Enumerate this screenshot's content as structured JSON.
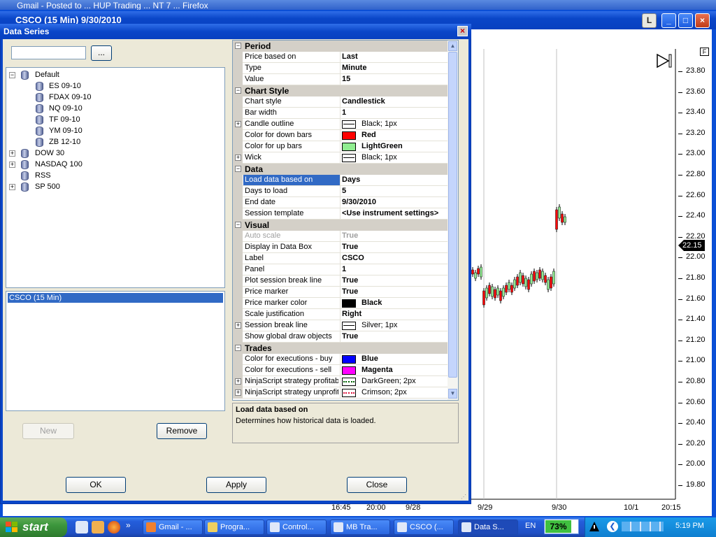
{
  "background": {
    "browser_title_fragment": "Gmail - Posted to ... HUP Trading ... NT 7 ... Firefox"
  },
  "chart_window": {
    "title": "CSCO (15 Min)  9/30/2010",
    "buttons": {
      "l": "L",
      "min": "_",
      "max": "□",
      "close": "×"
    },
    "flag": "F",
    "price_marker": "22.15",
    "y_ticks": [
      "23.80",
      "23.60",
      "23.40",
      "23.20",
      "23.00",
      "22.80",
      "22.60",
      "22.40",
      "22.20",
      "22.00",
      "21.80",
      "21.60",
      "21.40",
      "21.20",
      "21.00",
      "20.80",
      "20.60",
      "20.40",
      "20.20",
      "20.00",
      "19.80"
    ],
    "x_labels": [
      "16:45",
      "20:00",
      "9/28",
      "9/29",
      "9/30",
      "10/1",
      "20:15"
    ]
  },
  "dialog": {
    "title": "Data Series",
    "browse_button": "...",
    "tree": [
      {
        "label": "Default",
        "expanded": true,
        "children": [
          "ES 09-10",
          "FDAX 09-10",
          "NQ 09-10",
          "TF 09-10",
          "YM 09-10",
          "ZB 12-10"
        ]
      },
      {
        "label": "DOW 30"
      },
      {
        "label": "NASDAQ 100"
      },
      {
        "label": "RSS"
      },
      {
        "label": "SP 500"
      }
    ],
    "selected_series": "CSCO (15 Min)",
    "new_button": "New",
    "remove_button": "Remove",
    "ok_button": "OK",
    "apply_button": "Apply",
    "close_button": "Close",
    "help_title": "Load data based on",
    "help_text": "Determines how historical data is loaded."
  },
  "properties": [
    {
      "category": "Period"
    },
    {
      "name": "Price based on",
      "value": "Last"
    },
    {
      "name": "Type",
      "value": "Minute"
    },
    {
      "name": "Value",
      "value": "15"
    },
    {
      "category": "Chart Style"
    },
    {
      "name": "Chart style",
      "value": "Candlestick"
    },
    {
      "name": "Bar width",
      "value": "1"
    },
    {
      "name": "Candle outline",
      "value": "Black; 1px",
      "swatch": "#ffffff",
      "line": "solid",
      "expand": true
    },
    {
      "name": "Color for down bars",
      "value": "Red",
      "swatch": "#ff0000"
    },
    {
      "name": "Color for up bars",
      "value": "LightGreen",
      "swatch": "#90ee90"
    },
    {
      "name": "Wick",
      "value": "Black; 1px",
      "swatch": "#ffffff",
      "line": "solid",
      "expand": true
    },
    {
      "category": "Data"
    },
    {
      "name": "Load data based on",
      "value": "Days",
      "selected": true
    },
    {
      "name": "Days to load",
      "value": "5"
    },
    {
      "name": "End date",
      "value": "9/30/2010"
    },
    {
      "name": "Session template",
      "value": "<Use instrument settings>"
    },
    {
      "category": "Visual"
    },
    {
      "name": "Auto scale",
      "value": "True",
      "disabled": true
    },
    {
      "name": "Display in Data Box",
      "value": "True"
    },
    {
      "name": "Label",
      "value": "CSCO"
    },
    {
      "name": "Panel",
      "value": "1"
    },
    {
      "name": "Plot session break line",
      "value": "True"
    },
    {
      "name": "Price marker",
      "value": "True"
    },
    {
      "name": "Price marker color",
      "value": "Black",
      "swatch": "#000000"
    },
    {
      "name": "Scale justification",
      "value": "Right"
    },
    {
      "name": "Session break line",
      "value": "Silver; 1px",
      "swatch": "#ffffff",
      "line": "solid",
      "expand": true
    },
    {
      "name": "Show global draw objects",
      "value": "True"
    },
    {
      "category": "Trades"
    },
    {
      "name": "Color for executions - buy",
      "value": "Blue",
      "swatch": "#0000ff"
    },
    {
      "name": "Color for executions - sell",
      "value": "Magenta",
      "swatch": "#ff00ff"
    },
    {
      "name": "NinjaScript strategy profitable",
      "value": "DarkGreen; 2px",
      "swatch": "#ffffff",
      "line": "dot",
      "expand": true
    },
    {
      "name": "NinjaScript strategy unprofitable",
      "value": "Crimson; 2px",
      "swatch": "#ffffff",
      "line": "dotred",
      "expand": true
    }
  ],
  "taskbar": {
    "start": "start",
    "tasks": [
      "Gmail - ...",
      "Progra...",
      "Control...",
      "MB Tra...",
      "CSCO (...",
      "Data S..."
    ],
    "language": "EN",
    "battery": "73%",
    "clock": "5:19 PM"
  }
}
